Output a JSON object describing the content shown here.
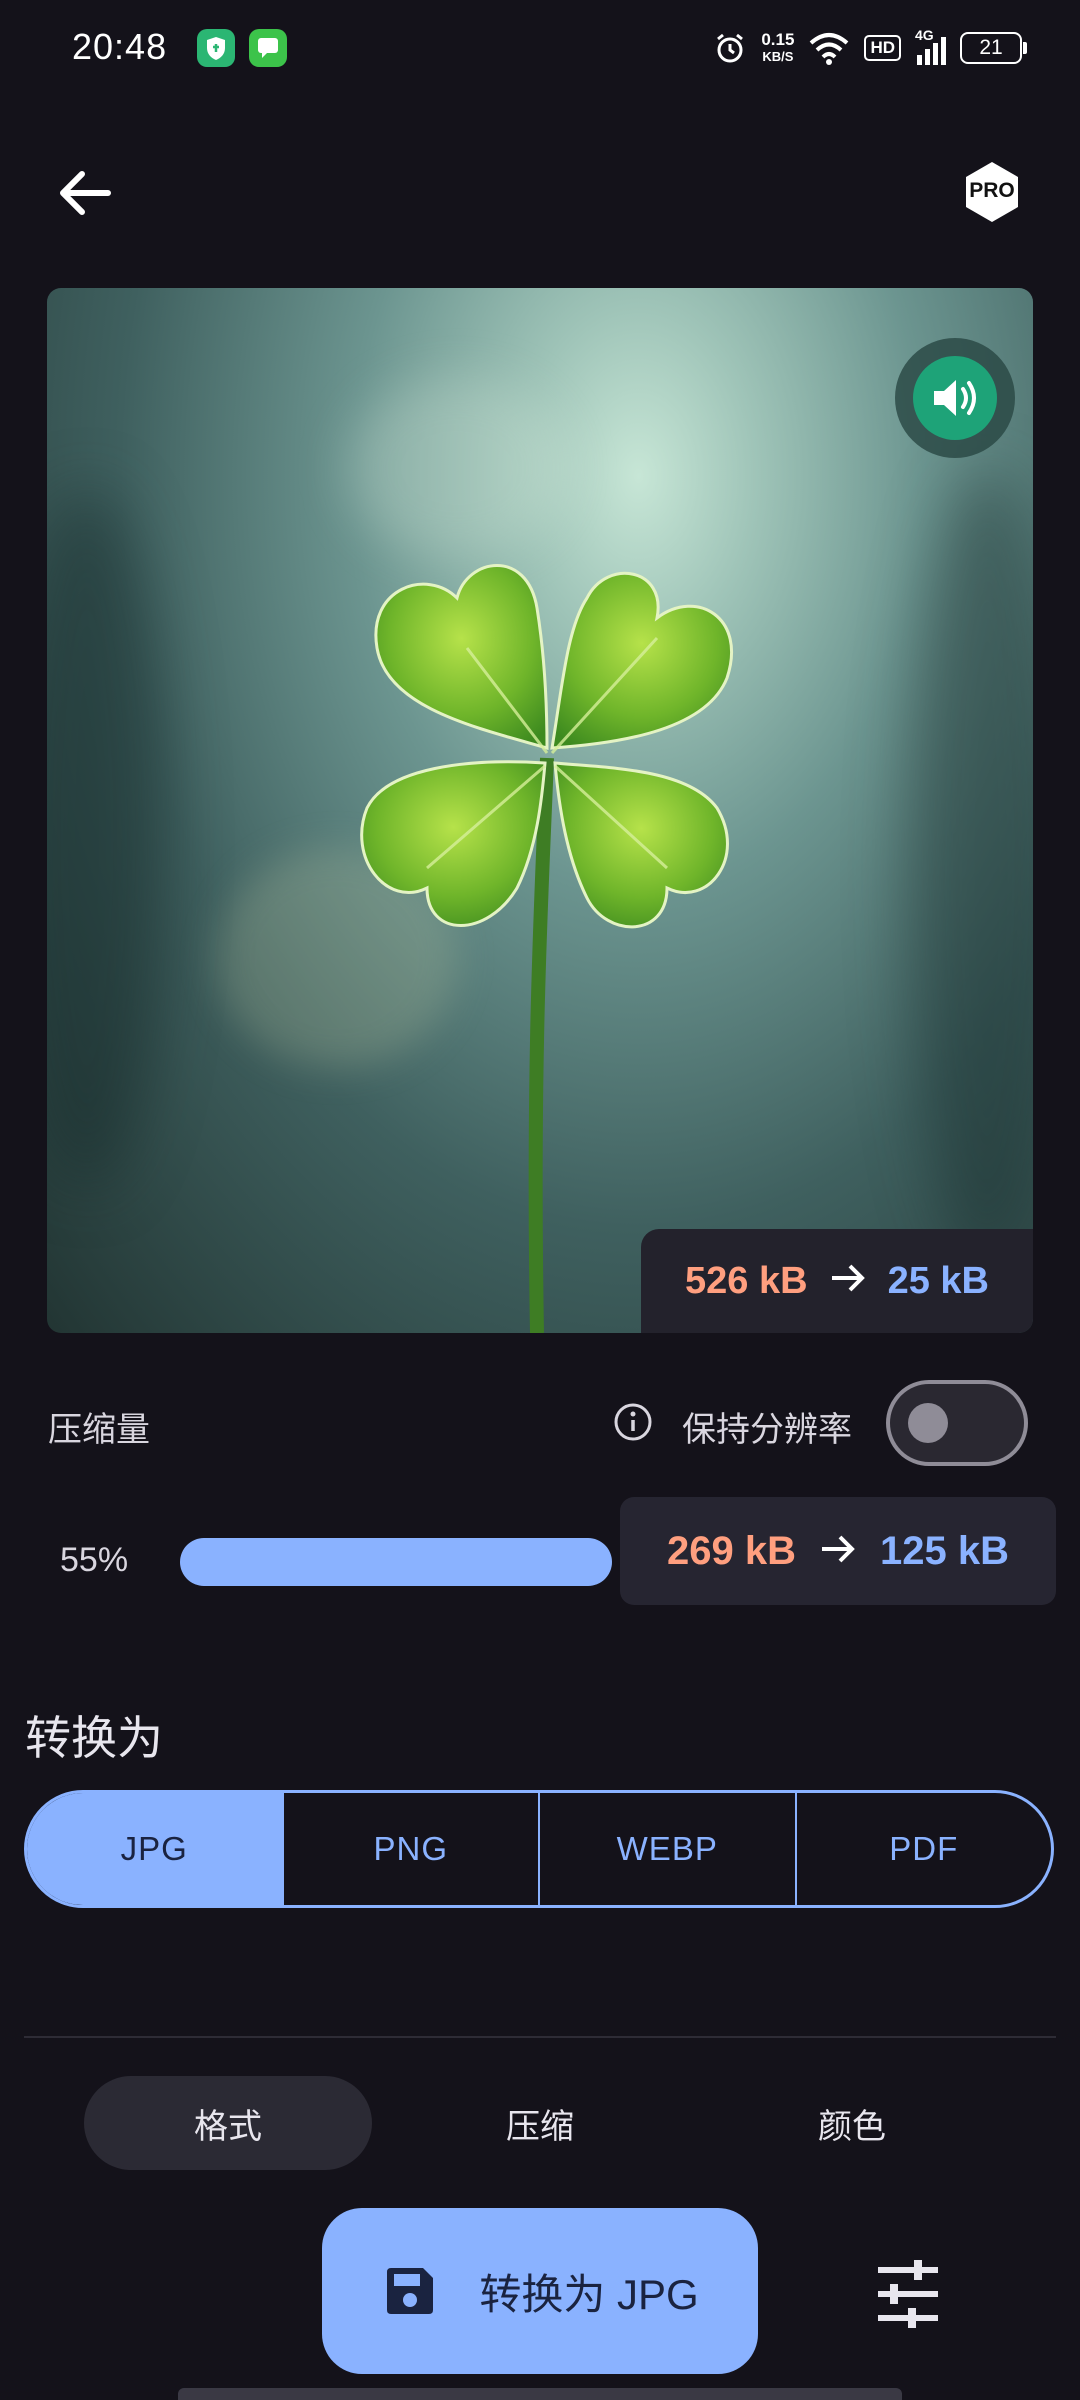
{
  "status_bar": {
    "time": "20:48",
    "net_speed_value": "0.15",
    "net_speed_unit": "KB/S",
    "hd": "HD",
    "signal": "4G",
    "battery": "21"
  },
  "header": {
    "back_icon": "arrow-left-icon",
    "pro_label": "PRO"
  },
  "preview": {
    "size_from": "526 kB",
    "size_to": "25 kB",
    "sound_icon": "volume-icon"
  },
  "compression": {
    "label": "压缩量",
    "keep_resolution_label": "保持分辨率",
    "keep_resolution_on": false,
    "percent_label": "55%",
    "level": 0.55,
    "est_from": "269 kB",
    "est_to": "125 kB"
  },
  "convert": {
    "title": "转换为",
    "formats": [
      "JPG",
      "PNG",
      "WEBP",
      "PDF"
    ],
    "selected": "JPG"
  },
  "tabs": {
    "format": "格式",
    "compress": "压缩",
    "color": "颜色"
  },
  "action": {
    "convert_label": "转换为 JPG",
    "save_icon": "save-icon",
    "tune_icon": "tune-icon"
  },
  "colors": {
    "accent": "#8ab2ff",
    "from_size": "#ff9f7f",
    "background": "#14121a",
    "sound_green": "#1ea378"
  }
}
